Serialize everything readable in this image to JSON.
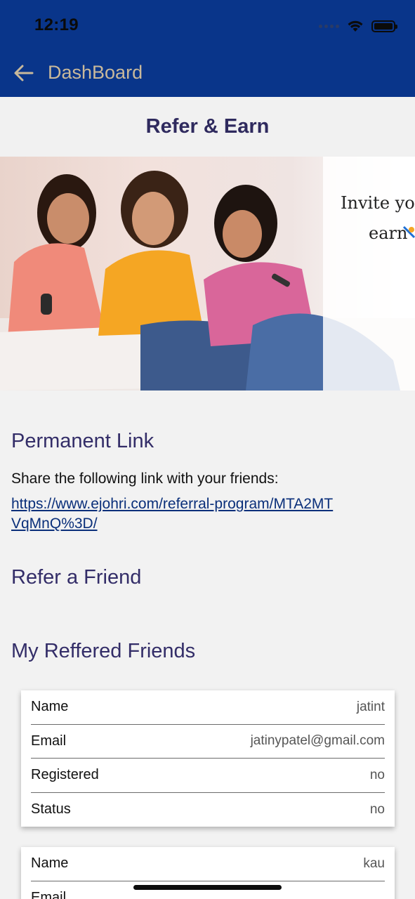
{
  "status_bar": {
    "time": "12:19"
  },
  "nav": {
    "back_icon": "arrow-left-icon",
    "title": "DashBoard"
  },
  "page": {
    "title": "Refer & Earn"
  },
  "banner": {
    "line1": "Invite you",
    "line2": "earn"
  },
  "permanent_link": {
    "heading": "Permanent Link",
    "share_text": "Share the following link with your friends:",
    "url": "https://www.ejohri.com/referral-program/MTA2MTVqMnQ%3D/"
  },
  "refer_friend": {
    "heading": "Refer a Friend"
  },
  "referred": {
    "heading": "My Reffered Friends",
    "labels": {
      "name": "Name",
      "email": "Email",
      "registered": "Registered",
      "status": "Status"
    },
    "friends": [
      {
        "name": "jatint",
        "email": "jatinypatel@gmail.com",
        "registered": "no",
        "status": "no"
      },
      {
        "name": "kau",
        "email": "",
        "registered": "",
        "status": ""
      }
    ]
  },
  "colors": {
    "header": "#09358a",
    "nav_title": "#c9b99b",
    "heading": "#332d68",
    "link": "#0a2f7a"
  }
}
